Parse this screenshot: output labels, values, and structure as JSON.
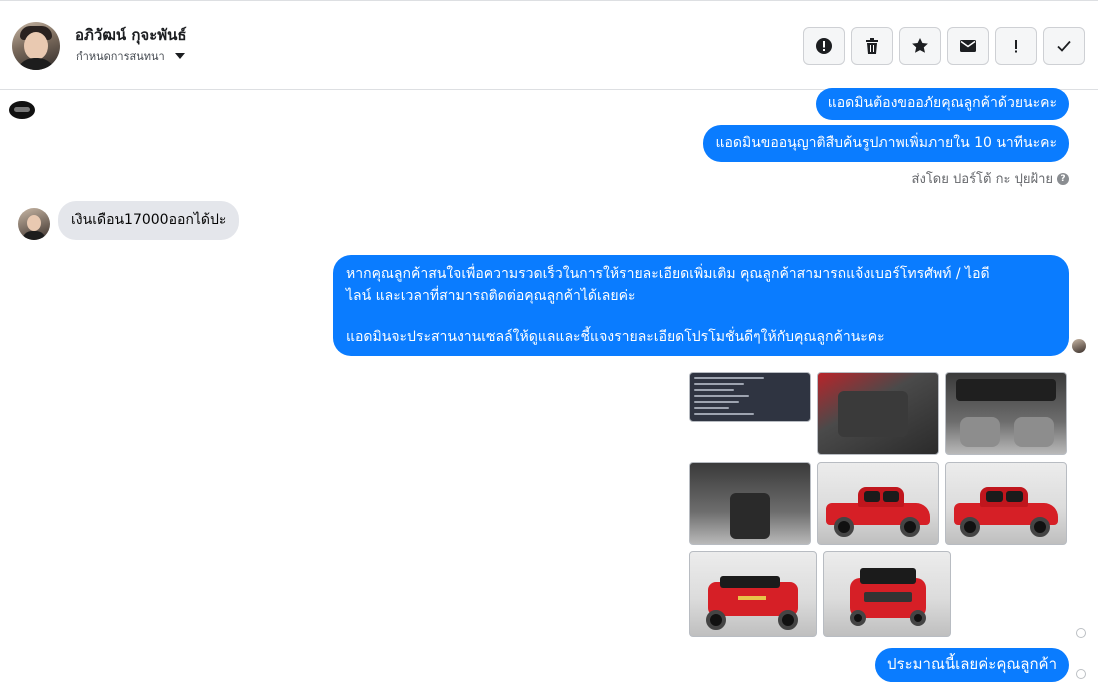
{
  "header": {
    "contact_name": "อภิวัฒน์ กุจะพันธ์",
    "assign_label": "กำหนดการสนทนา",
    "tools": [
      {
        "name": "spam",
        "label": "!",
        "icon": "alert-circle-icon"
      },
      {
        "name": "delete",
        "icon": "trash-icon"
      },
      {
        "name": "star",
        "icon": "star-icon"
      },
      {
        "name": "unread",
        "icon": "envelope-icon"
      },
      {
        "name": "follow-up",
        "label": "!",
        "icon": "exclamation-icon"
      },
      {
        "name": "done",
        "icon": "check-icon"
      }
    ]
  },
  "messages": [
    {
      "direction": "out",
      "text": "แอดมินต้องขออภัยคุณลูกค้าด้วยนะคะ"
    },
    {
      "direction": "out",
      "text": "แอดมินขออนุญาติสืบค้นรูปภาพเพิ่มภายใน 10 นาทีนะคะ"
    },
    {
      "sent_by": "ส่งโดย ปอร์โต้ กะ ปุยฝ้าย",
      "help": "?"
    },
    {
      "direction": "in",
      "text": "เงินเดือน17000ออกได้ปะ"
    },
    {
      "direction": "out",
      "lines": [
        "หากคุณลูกค้าสนใจเพื่อความรวดเร็วในการให้รายละเอียดเพิ่มเติม คุณลูกค้าสามารถแจ้งเบอร์โทรศัพท์ / ไอดี",
        "ไลน์ และเวลาที่สามารถติดต่อคุณลูกค้าได้เลยค่ะ",
        "แอดมินจะประสานงานเซลล์ให้ดูแลและชี้แจงรายละเอียดโปรโมชั่นดีๆให้กับคุณลูกค้านะคะ"
      ]
    },
    {
      "direction": "out",
      "text": "ประมาณนี้เลยค่ะคุณลูกค้า"
    }
  ],
  "photos": [
    "spec-sheet",
    "door-interior",
    "dashboard",
    "gear-console",
    "red-pickup-front-side",
    "red-pickup-side",
    "red-pickup-rear",
    "red-pickup-front"
  ],
  "colors": {
    "outgoing_bubble": "#0a7cff",
    "incoming_bubble": "#e4e6eb",
    "pickup_red": "#d61f26"
  }
}
